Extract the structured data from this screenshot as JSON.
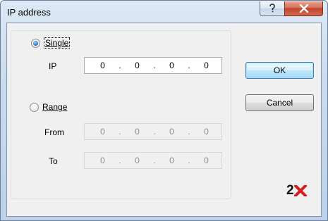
{
  "window": {
    "title": "IP address"
  },
  "titlebar": {
    "help_icon": "question-mark-icon",
    "close_icon": "close-x-icon"
  },
  "single": {
    "label": "Single",
    "checked": true,
    "ip_label": "IP",
    "octets": [
      "0",
      "0",
      "0",
      "0"
    ]
  },
  "range": {
    "label": "Range",
    "checked": false,
    "from_label": "From",
    "from_octets": [
      "0",
      "0",
      "0",
      "0"
    ],
    "to_label": "To",
    "to_octets": [
      "0",
      "0",
      "0",
      "0"
    ]
  },
  "buttons": {
    "ok": "OK",
    "cancel": "Cancel"
  },
  "logo": {
    "text": "2X"
  },
  "colors": {
    "close_red": "#c2412a",
    "logo_red": "#d41d1d",
    "default_button_border": "#3c7fb1"
  }
}
